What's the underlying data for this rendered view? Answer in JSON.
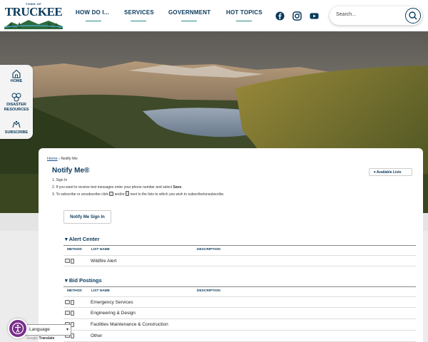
{
  "logo": {
    "small": "TOWN OF",
    "name": "TRUCKEE"
  },
  "nav": [
    {
      "label": "HOW DO I..."
    },
    {
      "label": "SERVICES"
    },
    {
      "label": "GOVERNMENT"
    },
    {
      "label": "HOT TOPICS"
    }
  ],
  "social": [
    "facebook-icon",
    "instagram-icon",
    "youtube-icon"
  ],
  "search": {
    "placeholder": "Search..."
  },
  "sidemenu": [
    {
      "label": "HOME",
      "icon": "home-icon"
    },
    {
      "label": "DISASTER RESOURCES",
      "icon": "disaster-icon"
    },
    {
      "label": "SUBSCRIBE",
      "icon": "subscribe-icon"
    }
  ],
  "breadcrumb": {
    "home": "Home",
    "sep": " › ",
    "current": "Notify Me"
  },
  "page": {
    "title": "Notify Me®",
    "available_lists": "Available Lists",
    "step1": "1. Sign In",
    "step2_a": "2. If you want to receive text messages enter your phone number and select ",
    "step2_b": "Save",
    "step2_c": ".",
    "step3_a": "3. To subscribe or unsubscribe click ",
    "step3_b": " and/or ",
    "step3_c": " next to the lists to which you wish to subscribe/unsubscribe.",
    "signin_button": "Notify Me Sign In"
  },
  "table_headers": {
    "method": "METHOD",
    "list_name": "LIST NAME",
    "description": "DESCRIPTION"
  },
  "sections": [
    {
      "title": "▾ Alert Center",
      "rows": [
        "Wildfire Alert"
      ]
    },
    {
      "title": "▾ Bid Postings",
      "rows": [
        "Emergency Services",
        "Engineering & Design",
        "Facilities Maintenance & Construction",
        "Other"
      ]
    }
  ],
  "translate": {
    "select": "Language",
    "google": "Google",
    "label": "Translate"
  },
  "colors": {
    "brand": "#0a3a5c",
    "accent": "#2a8a8a",
    "a11y": "#7a2e8c"
  }
}
